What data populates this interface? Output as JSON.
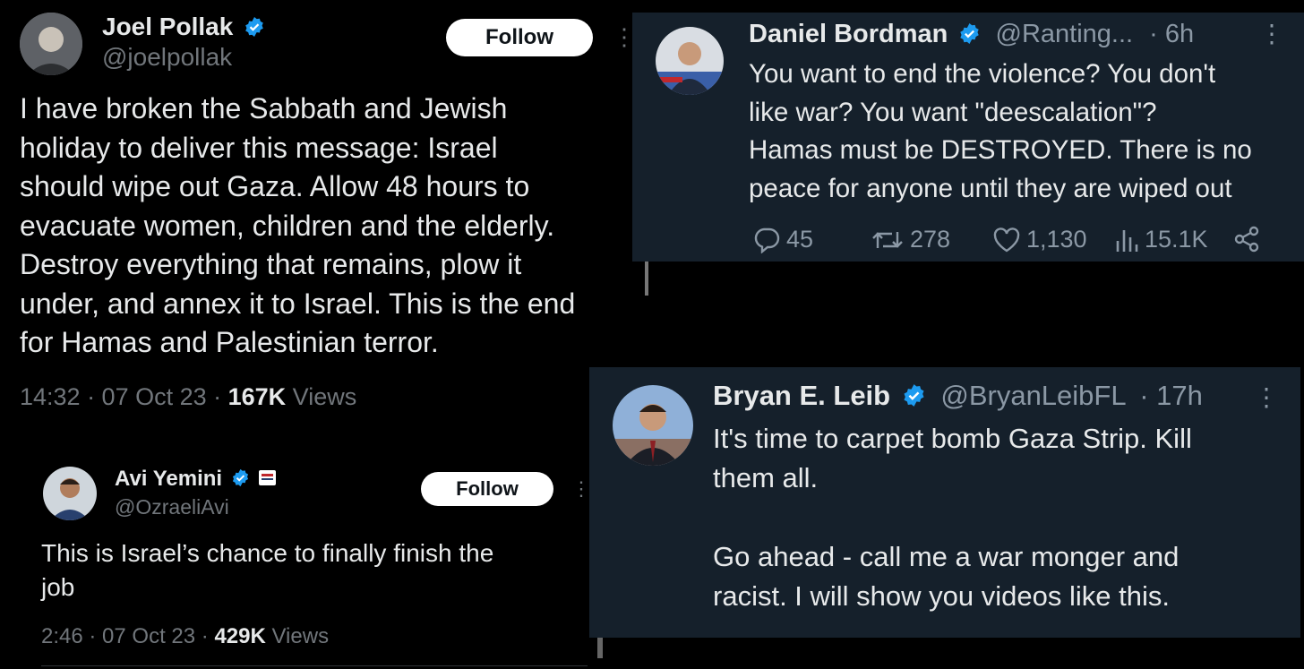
{
  "tweet_pollak": {
    "name": "Joel Pollak",
    "handle": "@joelpollak",
    "follow_label": "Follow",
    "text": "I have broken the Sabbath and Jewish\nholiday to deliver this message: Israel\nshould wipe out Gaza. Allow 48 hours to\nevacuate women, children and the elderly.\nDestroy everything that remains, plow it\nunder, and annex it to Israel. This is the end\nfor Hamas and Palestinian terror.",
    "time": "14:32 · 07 Oct 23 · ",
    "views_count": "167K",
    "views_label": " Views"
  },
  "tweet_bordman": {
    "name": "Daniel Bordman",
    "handle": "@Ranting...",
    "age": "· 6h",
    "text": "You want to end the violence? You don't\nlike war? You want \"deescalation\"?\nHamas must be DESTROYED. There is no\npeace for anyone until they are wiped out",
    "replies": "45",
    "retweets": "278",
    "likes": "1,130",
    "views": "15.1K"
  },
  "tweet_yemini": {
    "name": "Avi Yemini",
    "handle": "@OzraeliAvi",
    "follow_label": "Follow",
    "text": "This is Israel’s chance to finally finish the\njob",
    "time": "2:46 · 07 Oct 23 · ",
    "views_count": "429K",
    "views_label": " Views"
  },
  "tweet_leib": {
    "name": "Bryan E. Leib",
    "handle": "@BryanLeibFL",
    "age": "· 17h",
    "text": "It's time to carpet bomb Gaza Strip. Kill\nthem all.\n\nGo ahead - call me a war monger and\nracist. I will show you videos like this."
  },
  "colors": {
    "verified_blue": "#1d9bf0",
    "panel_dark": "#15202b",
    "muted_text": "#71767b"
  },
  "icons": [
    "verified-badge-icon",
    "more-icon",
    "reply-icon",
    "retweet-icon",
    "like-icon",
    "views-icon",
    "share-icon"
  ]
}
